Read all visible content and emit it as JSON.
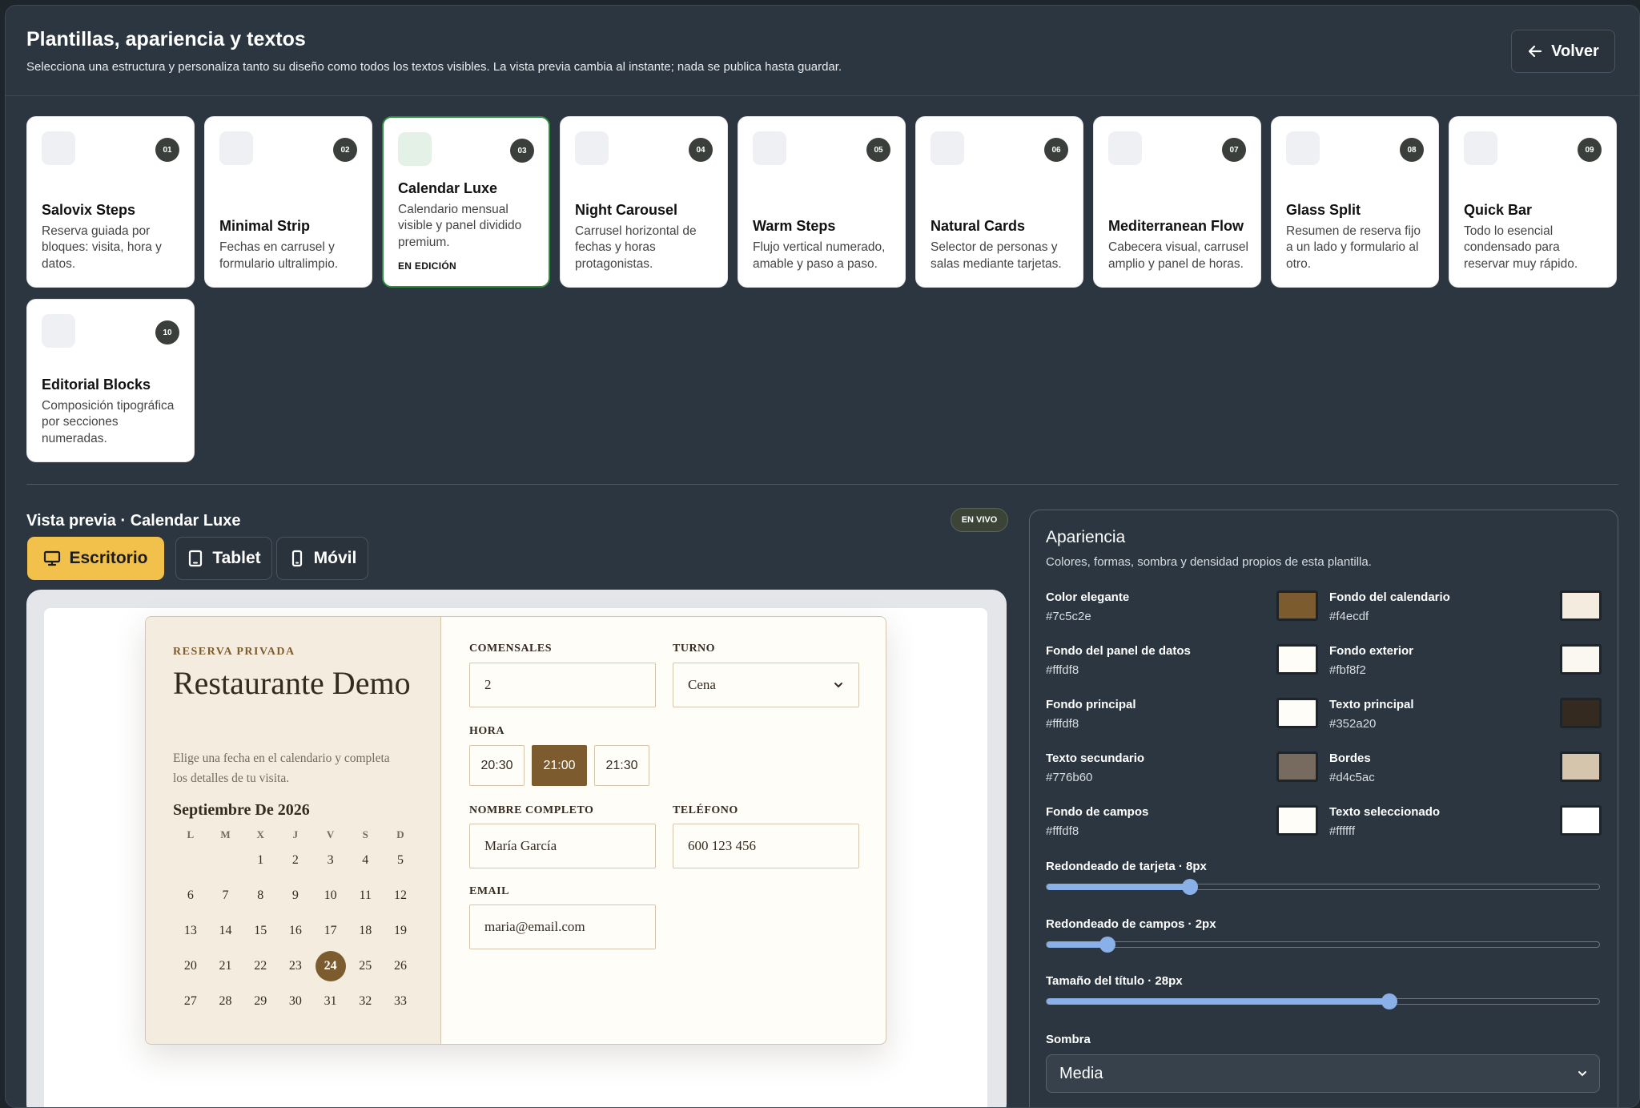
{
  "header": {
    "title": "Plantillas, apariencia y textos",
    "subtitle": "Selecciona una estructura y personaliza tanto su diseño como todos los textos visibles. La vista previa cambia al instante; nada se publica hasta guardar.",
    "back_label": "Volver"
  },
  "templates": [
    {
      "num": "01",
      "name": "Salovix Steps",
      "desc": "Reserva guiada por bloques: visita, hora y datos."
    },
    {
      "num": "02",
      "name": "Minimal Strip",
      "desc": "Fechas en carrusel y formulario ultralimpio."
    },
    {
      "num": "03",
      "name": "Calendar Luxe",
      "desc": "Calendario mensual visible y panel dividido premium.",
      "tag": "EN EDICIÓN"
    },
    {
      "num": "04",
      "name": "Night Carousel",
      "desc": "Carrusel horizontal de fechas y horas protagonistas."
    },
    {
      "num": "05",
      "name": "Warm Steps",
      "desc": "Flujo vertical numerado, amable y paso a paso."
    },
    {
      "num": "06",
      "name": "Natural Cards",
      "desc": "Selector de personas y salas mediante tarjetas."
    },
    {
      "num": "07",
      "name": "Mediterranean Flow",
      "desc": "Cabecera visual, carrusel amplio y panel de horas."
    },
    {
      "num": "08",
      "name": "Glass Split",
      "desc": "Resumen de reserva fijo a un lado y formulario al otro."
    },
    {
      "num": "09",
      "name": "Quick Bar",
      "desc": "Todo lo esencial condensado para reservar muy rápido."
    },
    {
      "num": "10",
      "name": "Editorial Blocks",
      "desc": "Composición tipográfica por secciones numeradas."
    }
  ],
  "preview": {
    "title": "Vista previa · Calendar Luxe",
    "live_badge": "EN VIVO",
    "devices": [
      "Escritorio",
      "Tablet",
      "Móvil"
    ],
    "active_device": "Escritorio"
  },
  "widget": {
    "kicker": "RESERVA PRIVADA",
    "restaurant": "Restaurante Demo",
    "description": "Elige una fecha en el calendario y completa los detalles de tu visita.",
    "calendar_title": "Septiembre De 2026",
    "weekdays": [
      "L",
      "M",
      "X",
      "J",
      "V",
      "S",
      "D"
    ],
    "days": [
      "",
      "",
      "1",
      "2",
      "3",
      "4",
      "5",
      "6",
      "7",
      "8",
      "9",
      "10",
      "11",
      "12",
      "13",
      "14",
      "15",
      "16",
      "17",
      "18",
      "19",
      "20",
      "21",
      "22",
      "23",
      "24",
      "25",
      "26",
      "27",
      "28",
      "29",
      "30",
      "31",
      "32",
      "33"
    ],
    "selected_day": "24",
    "labels": {
      "guests": "COMENSALES",
      "shift": "TURNO",
      "time": "HORA",
      "name": "NOMBRE COMPLETO",
      "phone": "TELÉFONO",
      "email": "EMAIL"
    },
    "values": {
      "guests": "2",
      "shift": "Cena",
      "name": "María García",
      "phone": "600 123 456",
      "email": "maria@email.com"
    },
    "time_slots": [
      "20:30",
      "21:00",
      "21:30"
    ],
    "selected_slot": "21:00"
  },
  "appearance": {
    "title": "Apariencia",
    "subtitle": "Colores, formas, sombra y densidad propios de esta plantilla.",
    "colors": [
      {
        "label": "Color elegante",
        "hex": "#7c5c2e"
      },
      {
        "label": "Fondo del calendario",
        "hex": "#f4ecdf"
      },
      {
        "label": "Fondo del panel de datos",
        "hex": "#fffdf8"
      },
      {
        "label": "Fondo exterior",
        "hex": "#fbf8f2"
      },
      {
        "label": "Fondo principal",
        "hex": "#fffdf8"
      },
      {
        "label": "Texto principal",
        "hex": "#352a20"
      },
      {
        "label": "Texto secundario",
        "hex": "#776b60"
      },
      {
        "label": "Bordes",
        "hex": "#d4c5ac"
      },
      {
        "label": "Fondo de campos",
        "hex": "#fffdf8"
      },
      {
        "label": "Texto seleccionado",
        "hex": "#ffffff"
      }
    ],
    "sliders": [
      {
        "label": "Redondeado de tarjeta · 8px",
        "fraction": 0.26
      },
      {
        "label": "Redondeado de campos · 2px",
        "fraction": 0.11
      },
      {
        "label": "Tamaño del título · 28px",
        "fraction": 0.62
      }
    ],
    "shadow_label": "Sombra",
    "shadow_value": "Media"
  }
}
